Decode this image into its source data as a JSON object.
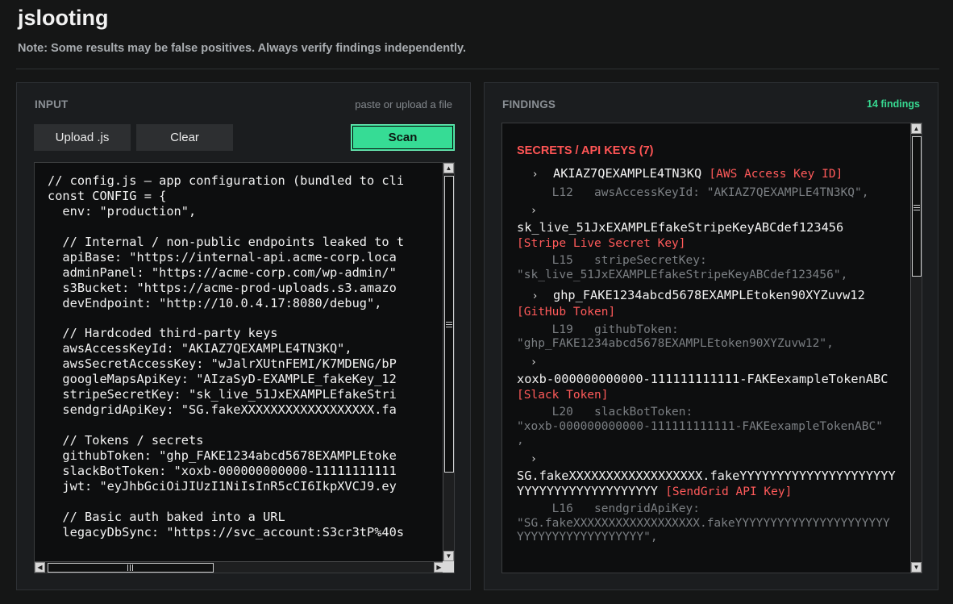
{
  "app": {
    "title": "jslooting",
    "note": "Note: Some results may be false positives. Always verify findings independently."
  },
  "input_panel": {
    "label": "INPUT",
    "hint": "paste or upload a file",
    "upload_label": "Upload .js",
    "clear_label": "Clear",
    "scan_label": "Scan",
    "code_lines": [
      "// config.js — app configuration (bundled to cli",
      "const CONFIG = {",
      "  env: \"production\",",
      "",
      "  // Internal / non-public endpoints leaked to t",
      "  apiBase: \"https://internal-api.acme-corp.loca",
      "  adminPanel: \"https://acme-corp.com/wp-admin/\"",
      "  s3Bucket: \"https://acme-prod-uploads.s3.amazo",
      "  devEndpoint: \"http://10.0.4.17:8080/debug\",",
      "",
      "  // Hardcoded third-party keys",
      "  awsAccessKeyId: \"AKIAZ7QEXAMPLE4TN3KQ\",",
      "  awsSecretAccessKey: \"wJalrXUtnFEMI/K7MDENG/bP",
      "  googleMapsApiKey: \"AIzaSyD-EXAMPLE_fakeKey_12",
      "  stripeSecretKey: \"sk_live_51JxEXAMPLEfakeStri",
      "  sendgridApiKey: \"SG.fakeXXXXXXXXXXXXXXXXXX.fa",
      "",
      "  // Tokens / secrets",
      "  githubToken: \"ghp_FAKE1234abcd5678EXAMPLEtoke",
      "  slackBotToken: \"xoxb-000000000000-11111111111",
      "  jwt: \"eyJhbGciOiJIUzI1NiIsInR5cCI6IkpXVCJ9.ey",
      "",
      "  // Basic auth baked into a URL",
      "  legacyDbSync: \"https://svc_account:S3cr3tP%40s"
    ]
  },
  "findings_panel": {
    "label": "FINDINGS",
    "count": "14 findings",
    "section": {
      "title": "SECRETS / API KEYS  (7)",
      "items": [
        {
          "value": "AKIAZ7QEXAMPLE4TN3KQ",
          "tag": "[AWS Access Key ID]",
          "context": "     L12   awsAccessKeyId: \"AKIAZ7QEXAMPLE4TN3KQ\","
        },
        {
          "value": "sk_live_51JxEXAMPLEfakeStripeKeyABCdef123456",
          "tag": "[Stripe Live Secret Key]",
          "context": "     L15   stripeSecretKey:\n\"sk_live_51JxEXAMPLEfakeStripeKeyABCdef123456\","
        },
        {
          "value": "ghp_FAKE1234abcd5678EXAMPLEtoken90XYZuvw12",
          "tag": "[GitHub Token]",
          "context": "     L19   githubToken:\n\"ghp_FAKE1234abcd5678EXAMPLEtoken90XYZuvw12\","
        },
        {
          "value": "xoxb-000000000000-111111111111-FAKEexampleTokenABC",
          "tag": "[Slack Token]",
          "context": "     L20   slackBotToken:\n\"xoxb-000000000000-111111111111-FAKEexampleTokenABC\"\n,"
        },
        {
          "value": "SG.fakeXXXXXXXXXXXXXXXXXX.fakeYYYYYYYYYYYYYYYYYYYYYYYYYYYYYYYYYYYYYYYY",
          "tag": "[SendGrid API Key]",
          "context": "     L16   sendgridApiKey:\n\"SG.fakeXXXXXXXXXXXXXXXXXX.fakeYYYYYYYYYYYYYYYYYYYYYYYYYYYYYYYYYYYYYYYY\","
        }
      ]
    }
  },
  "icons": {
    "scroll_up": "triangle-up-icon",
    "scroll_down": "triangle-down-icon",
    "scroll_left": "triangle-left-icon",
    "scroll_right": "triangle-right-icon",
    "expand": "chevron-right-icon"
  },
  "colors": {
    "accent": "#36dc95",
    "danger": "#ff5555",
    "background": "#151616"
  }
}
